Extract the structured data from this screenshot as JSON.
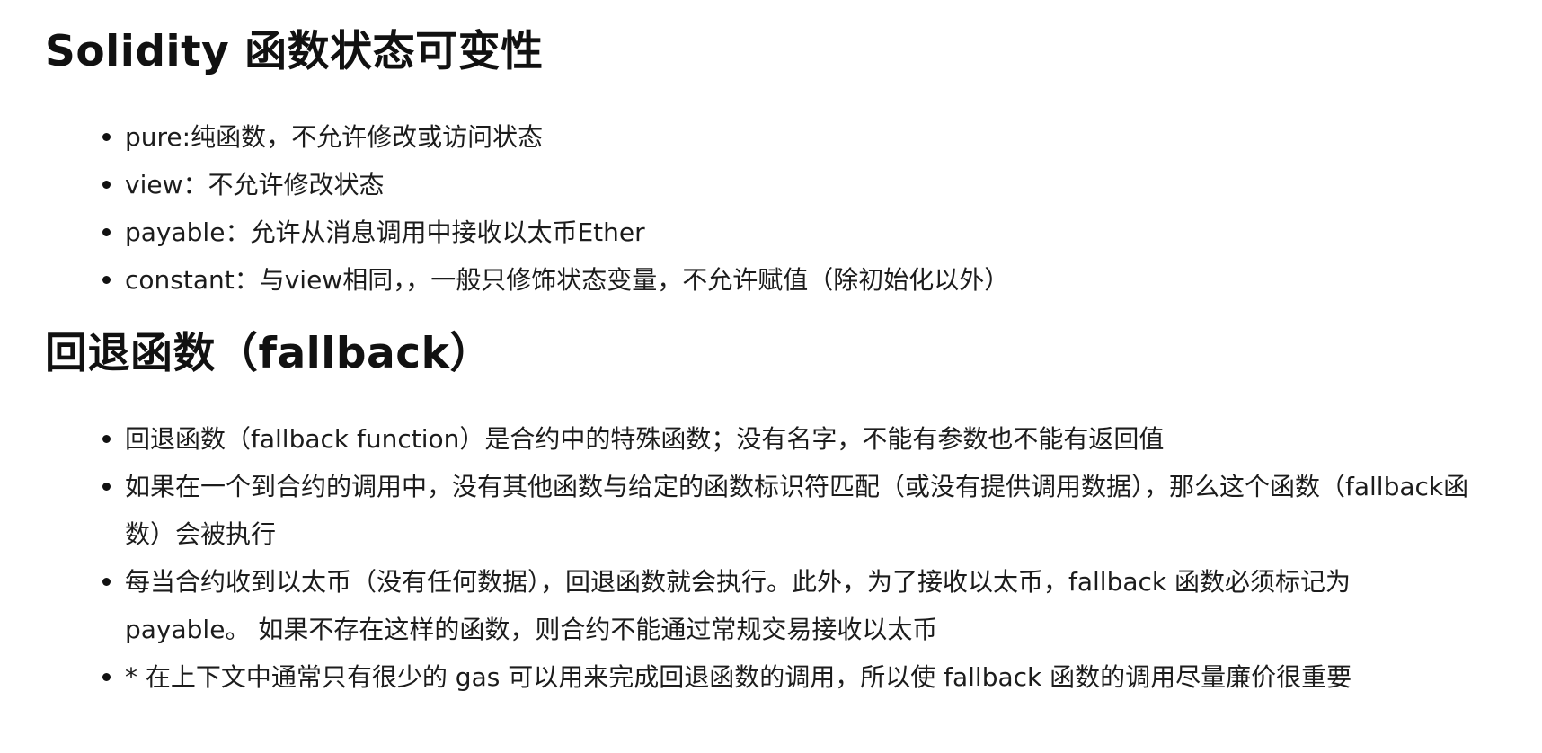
{
  "sections": [
    {
      "heading": "Solidity 函数状态可变性",
      "items": [
        "pure:纯函数，不允许修改或访问状态",
        "view：不允许修改状态",
        "payable：允许从消息调用中接收以太币Ether",
        "constant：与view相同，，一般只修饰状态变量，不允许赋值（除初始化以外）"
      ]
    },
    {
      "heading": "回退函数（fallback）",
      "items": [
        "回退函数（fallback function）是合约中的特殊函数；没有名字，不能有参数也不能有返回值",
        "如果在一个到合约的调用中，没有其他函数与给定的函数标识符匹配（或没有提供调用数据），那么这个函数（fallback函数）会被执行",
        "每当合约收到以太币（没有任何数据），回退函数就会执行。此外，为了接收以太币，fallback 函数必须标记为payable。 如果不存在这样的函数，则合约不能通过常规交易接收以太币",
        "* 在上下文中通常只有很少的 gas 可以用来完成回退函数的调用，所以使 fallback 函数的调用尽量廉价很重要"
      ]
    }
  ]
}
